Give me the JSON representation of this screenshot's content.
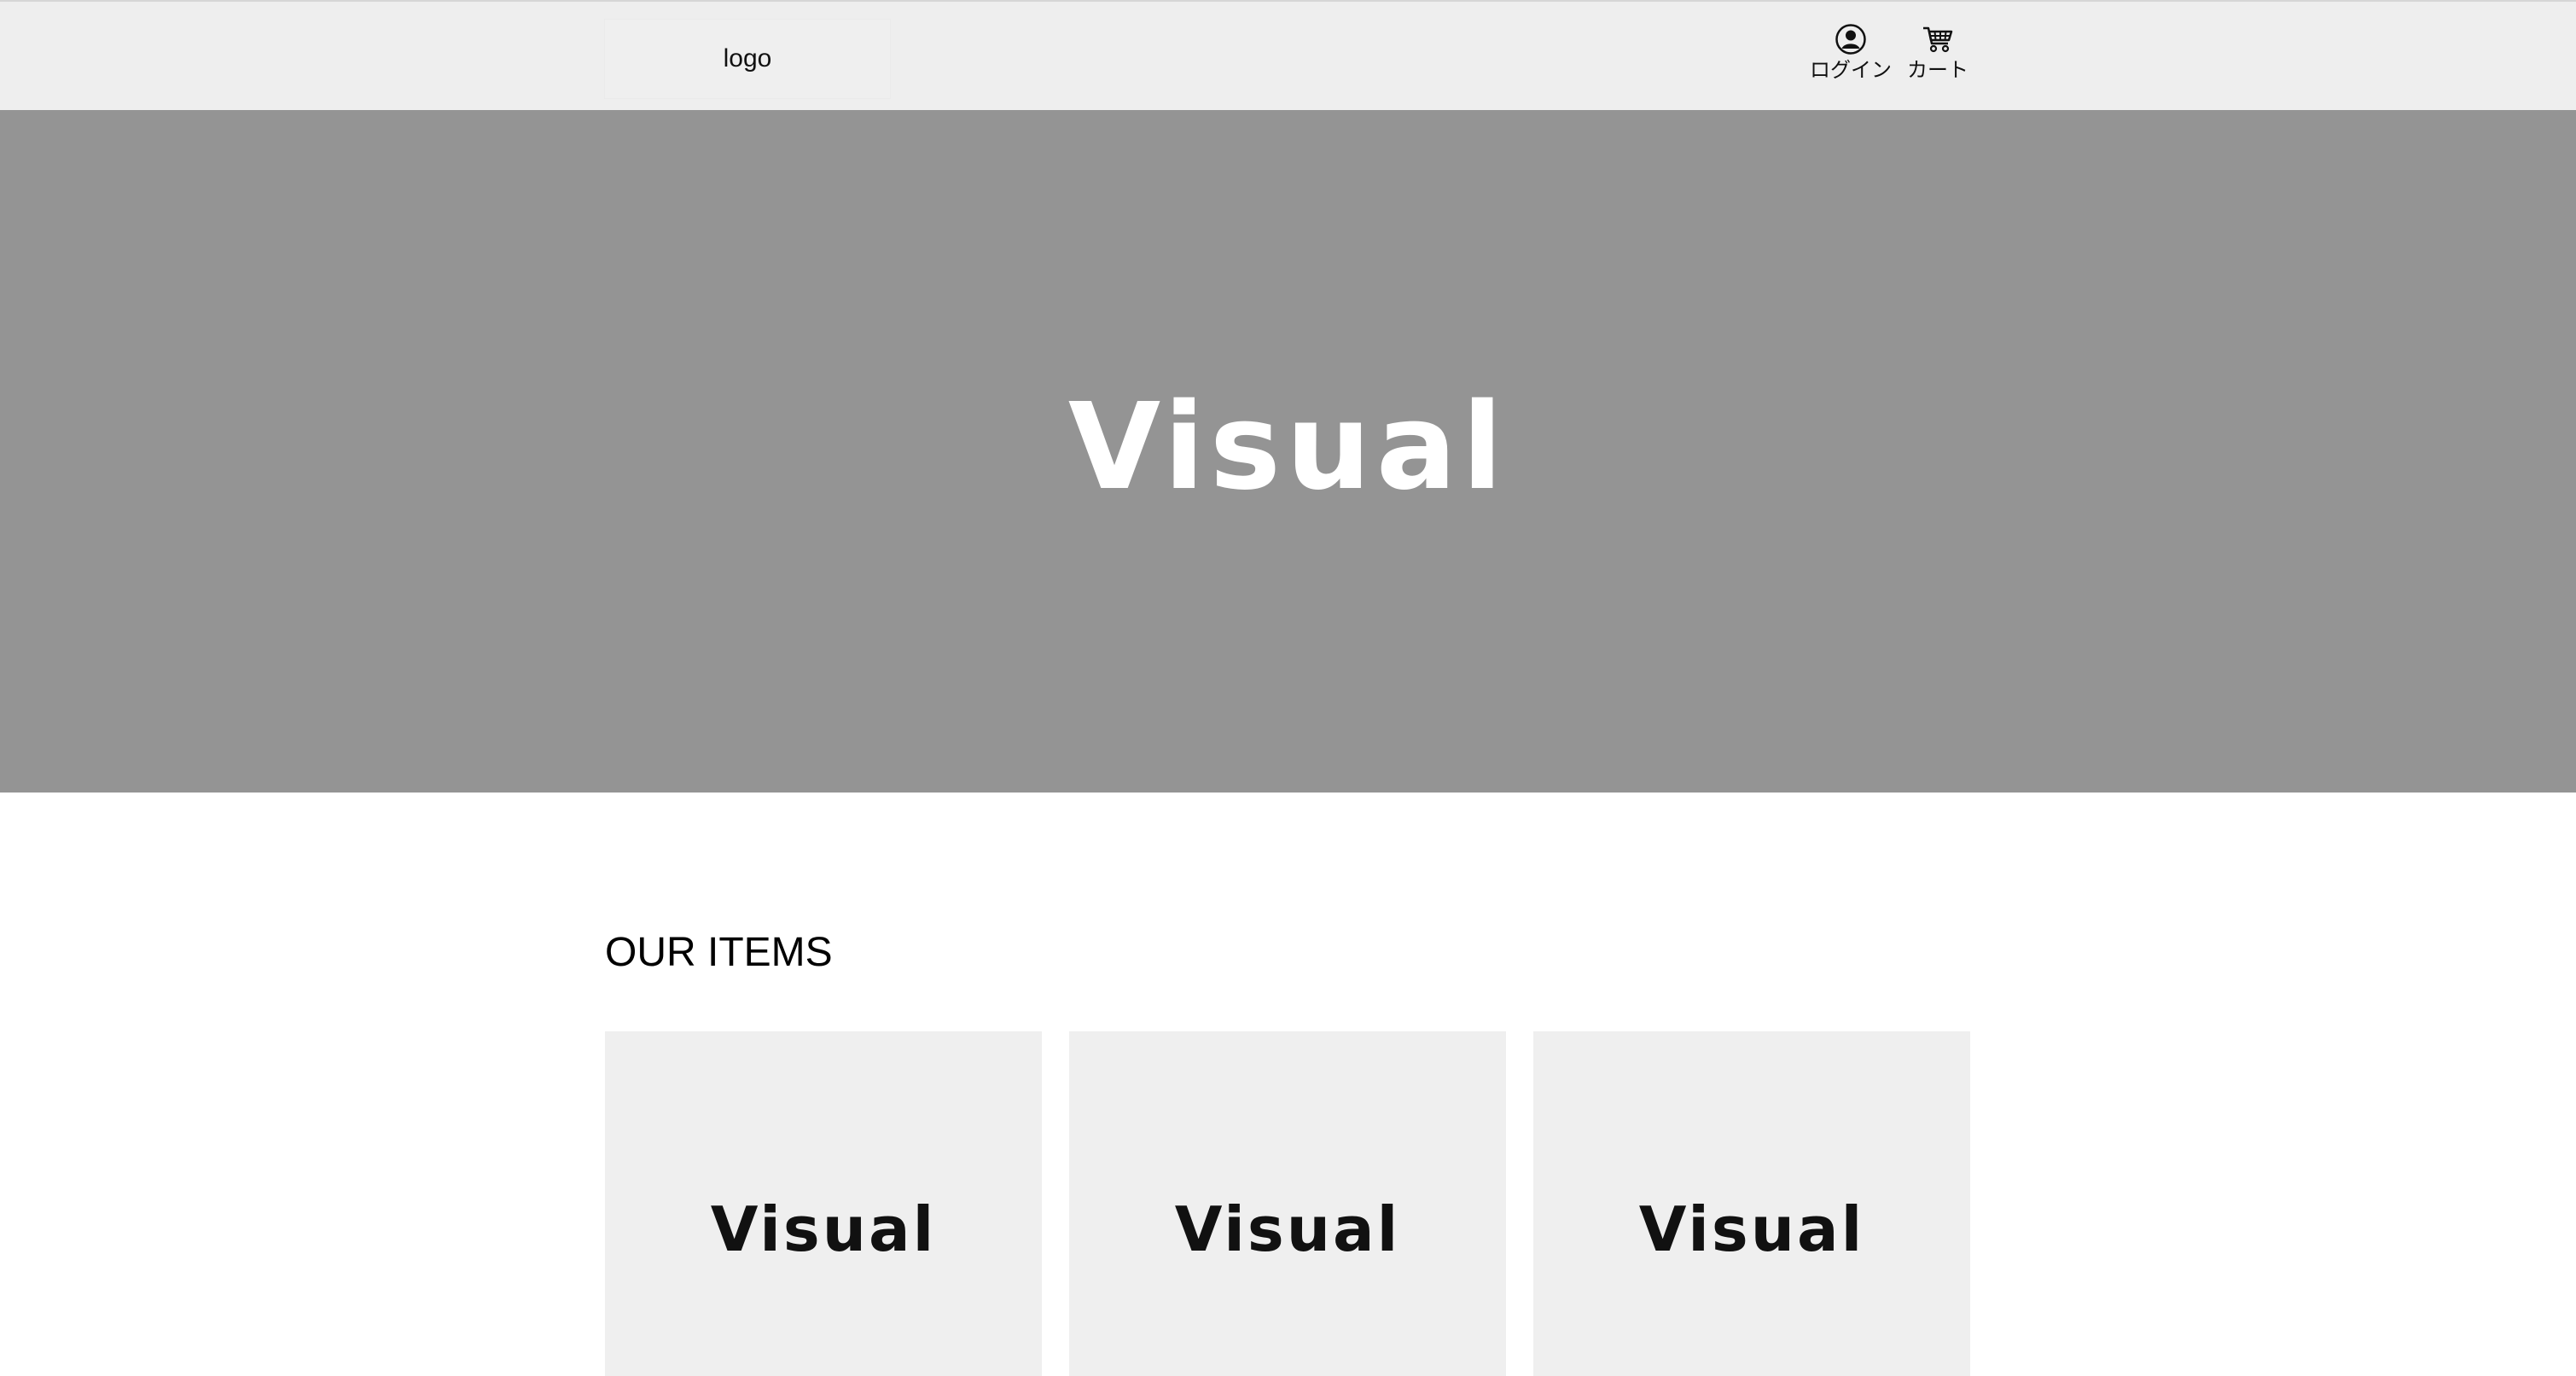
{
  "header": {
    "logo_text": "logo",
    "login_label": "ログイン",
    "cart_label": "カート",
    "login_icon": "user-circle-icon",
    "cart_icon": "shopping-cart-icon"
  },
  "hero": {
    "text": "Visual"
  },
  "items_section": {
    "title": "OUR ITEMS",
    "items": [
      {
        "text": "Visual"
      },
      {
        "text": "Visual"
      },
      {
        "text": "Visual"
      }
    ]
  },
  "colors": {
    "header_bg": "#eeeeee",
    "hero_bg": "#949494",
    "card_bg": "#efefef",
    "page_bg": "#ffffff"
  }
}
